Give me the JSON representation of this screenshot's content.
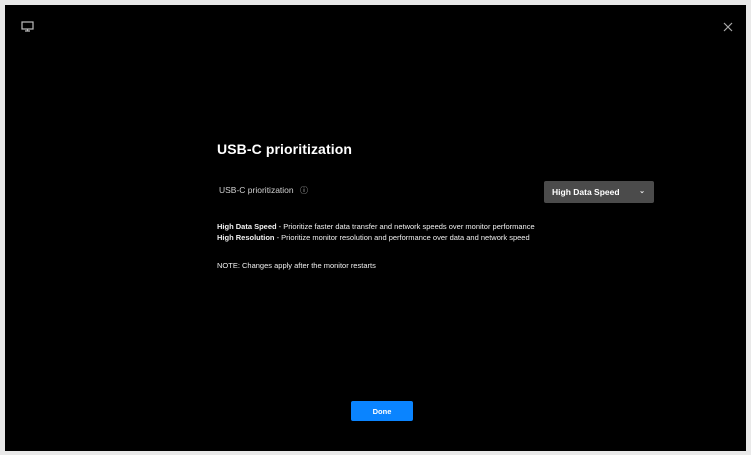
{
  "window": {
    "app_icon": "monitor-icon",
    "close_icon": "close-icon"
  },
  "dialog": {
    "title": "USB-C prioritization",
    "setting": {
      "label": "USB-C prioritization",
      "info_icon": "info-icon",
      "dropdown_value": "High Data Speed",
      "dropdown_arrow": "chevron-down-icon"
    },
    "descriptions": [
      {
        "strong": "High Data Speed",
        "text": " - Prioritize faster data transfer and network speeds over monitor performance"
      },
      {
        "strong": "High Resolution",
        "text": " - Prioritize monitor resolution and performance over data and network speed"
      }
    ],
    "note": "NOTE: Changes apply after the monitor restarts",
    "done_label": "Done"
  },
  "colors": {
    "background": "#000000",
    "outer_frame": "#e9e9e9",
    "dropdown": "#4b4b4b",
    "accent": "#0a84ff",
    "text": "#ffffff"
  }
}
